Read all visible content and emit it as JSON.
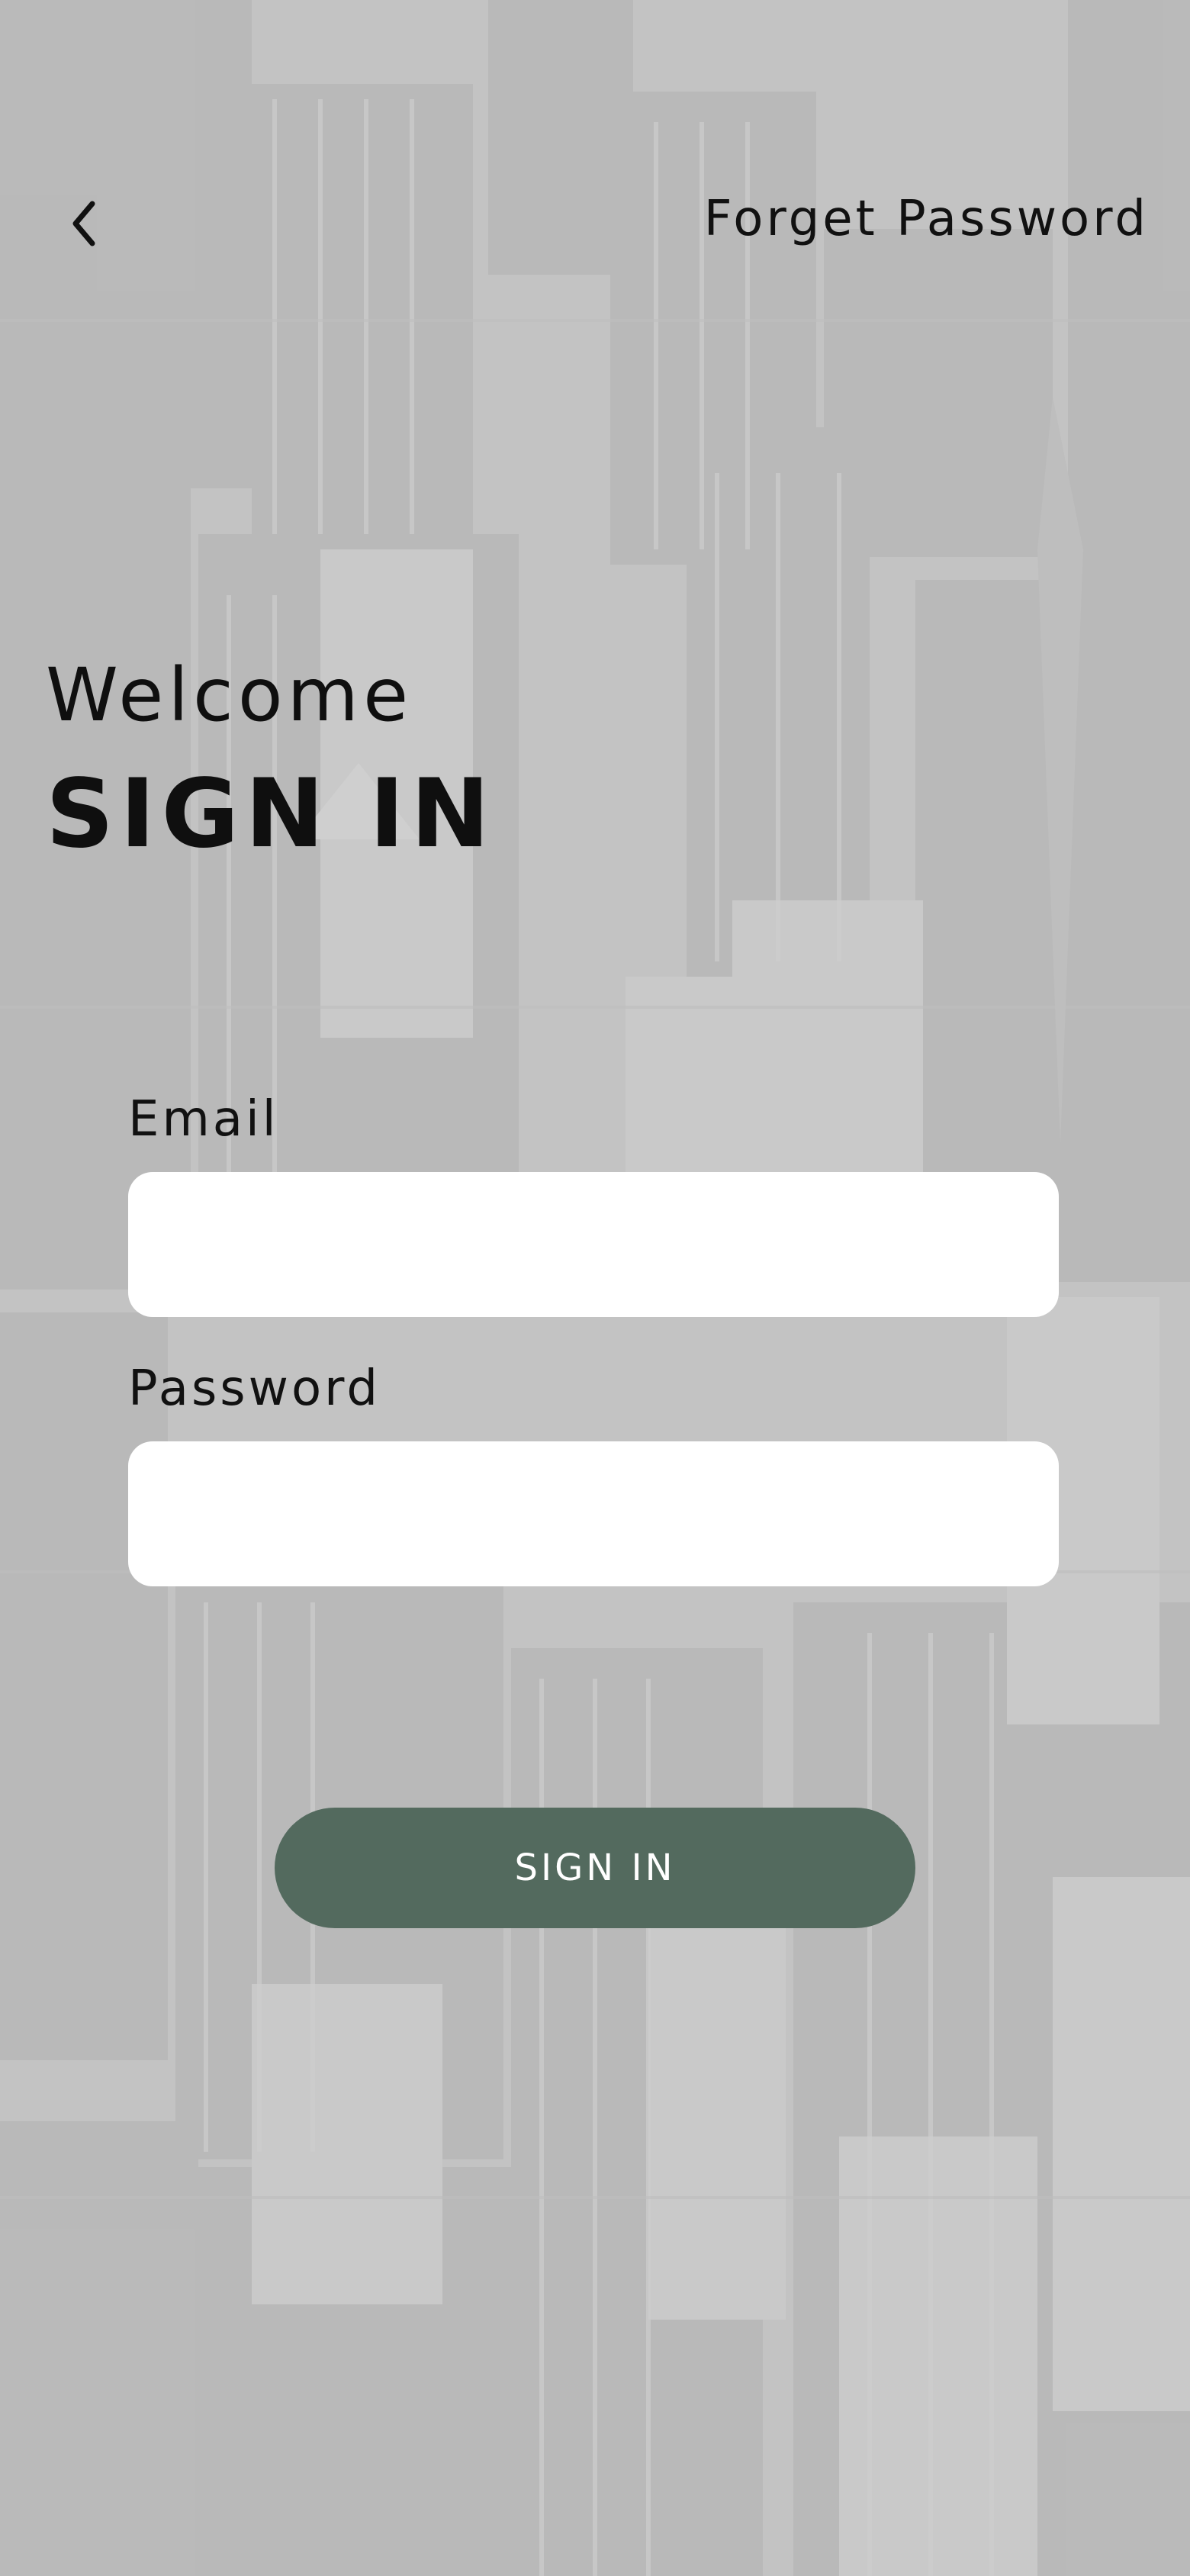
{
  "header": {
    "back_icon": "chevron-left-icon",
    "forget_password_label": "Forget Password"
  },
  "intro": {
    "welcome": "Welcome",
    "title": "SIGN IN"
  },
  "form": {
    "email_label": "Email",
    "email_value": "",
    "password_label": "Password",
    "password_value": "",
    "submit_label": "SIGN IN"
  },
  "colors": {
    "button": "#536a5e",
    "button_text": "#ffffff",
    "field_background": "#ffffff",
    "text": "#111111",
    "overlay": "#d6d6d6"
  }
}
